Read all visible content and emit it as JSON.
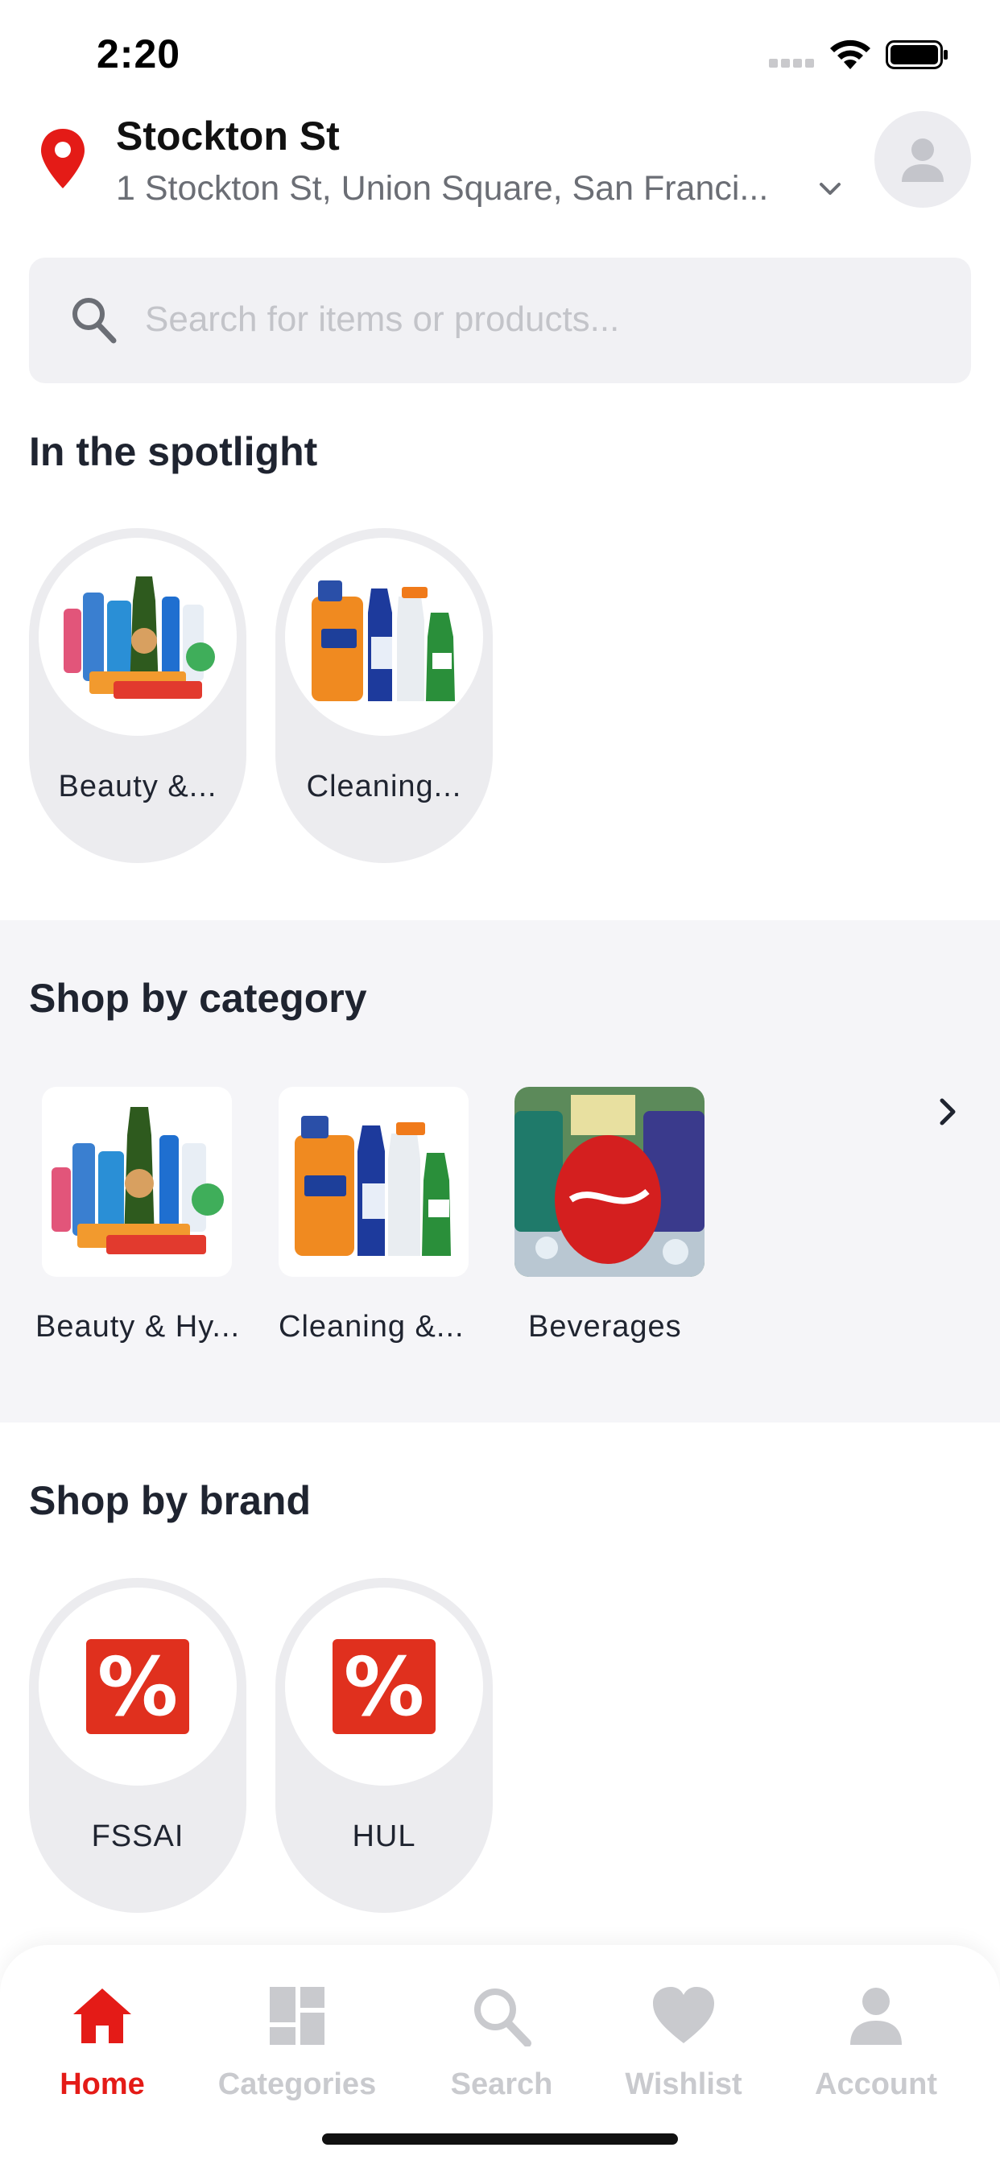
{
  "status_bar": {
    "time": "2:20"
  },
  "header": {
    "location_title": "Stockton St",
    "location_address": "1 Stockton St, Union Square, San Franci..."
  },
  "search": {
    "placeholder": "Search for items or products..."
  },
  "spotlight": {
    "title": "In the spotlight",
    "items": [
      {
        "label": "Beauty &...",
        "image": "beauty-products-photo"
      },
      {
        "label": "Cleaning...",
        "image": "cleaning-products-photo"
      }
    ]
  },
  "categories": {
    "title": "Shop by category",
    "items": [
      {
        "label": "Beauty & Hy...",
        "image": "beauty-products-photo"
      },
      {
        "label": "Cleaning &...",
        "image": "cleaning-products-photo"
      },
      {
        "label": "Beverages",
        "image": "beverages-photo"
      }
    ]
  },
  "brands": {
    "title": "Shop by brand",
    "items": [
      {
        "label": "FSSAI",
        "badge": "%"
      },
      {
        "label": "HUL",
        "badge": "%"
      }
    ]
  },
  "bottom_nav": {
    "items": [
      {
        "label": "Home",
        "icon": "home-icon",
        "active": true
      },
      {
        "label": "Categories",
        "icon": "grid-icon",
        "active": false
      },
      {
        "label": "Search",
        "icon": "search-icon",
        "active": false
      },
      {
        "label": "Wishlist",
        "icon": "heart-icon",
        "active": false
      },
      {
        "label": "Account",
        "icon": "person-icon",
        "active": false
      }
    ]
  },
  "colors": {
    "accent": "#e41b17",
    "brand_badge": "#e0301e",
    "inactive_nav": "#c9cace",
    "card_bg": "#ececef"
  }
}
